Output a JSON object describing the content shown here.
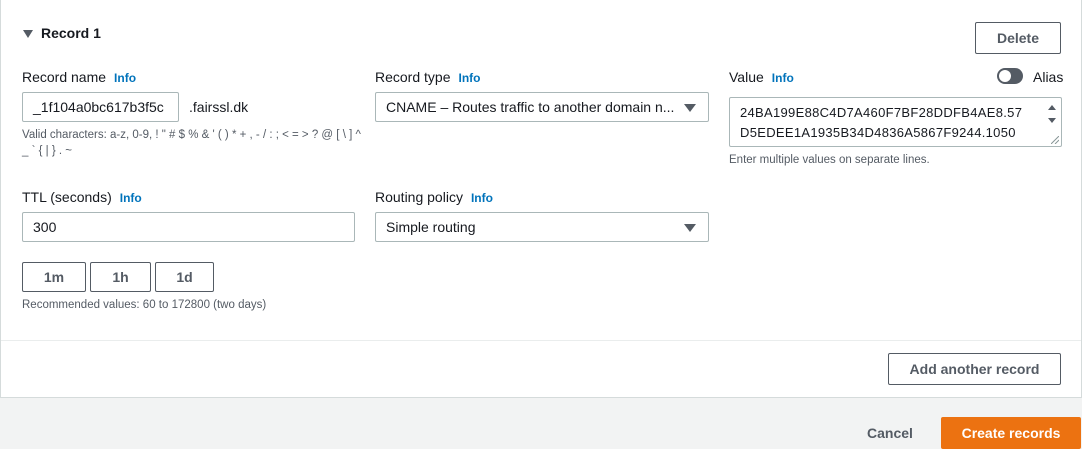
{
  "record": {
    "title": "Record 1",
    "delete_label": "Delete"
  },
  "record_name": {
    "label": "Record name",
    "info": "Info",
    "value": "_1f104a0bc617b3f5c",
    "suffix": ".fairssl.dk",
    "hint": "Valid characters: a-z, 0-9, ! \" # $ % & ' ( ) * + , - / : ; < = > ? @ [ \\ ] ^ _ ` { | } . ~"
  },
  "record_type": {
    "label": "Record type",
    "info": "Info",
    "value": "CNAME – Routes traffic to another domain n..."
  },
  "value_field": {
    "label": "Value",
    "info": "Info",
    "line1": "24BA199E88C4D7A460F7BF28DDFB4AE8.57",
    "line2": "D5EDEE1A1935B34D4836A5867F9244.1050",
    "hint": "Enter multiple values on separate lines.",
    "alias_label": "Alias",
    "alias_on": false
  },
  "ttl": {
    "label": "TTL (seconds)",
    "info": "Info",
    "value": "300",
    "presets": [
      "1m",
      "1h",
      "1d"
    ],
    "hint": "Recommended values: 60 to 172800 (two days)"
  },
  "routing_policy": {
    "label": "Routing policy",
    "info": "Info",
    "value": "Simple routing"
  },
  "actions": {
    "add_another": "Add another record",
    "cancel": "Cancel",
    "create": "Create records"
  },
  "colors": {
    "primary": "#ec7211",
    "link": "#0073bb",
    "border": "#aab7b8",
    "text_muted": "#545b64"
  },
  "icons": {
    "expand": "caret-down-icon",
    "select": "dropdown-arrow-icon",
    "toggle": "toggle-icon"
  }
}
